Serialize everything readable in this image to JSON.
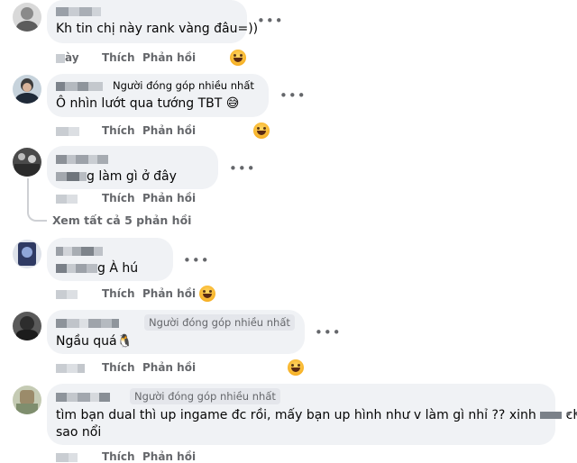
{
  "comments": [
    {
      "name_blur": true,
      "badge": "",
      "text": "Kh tin chị này rank vàng đâu=))",
      "time_blur": "ày",
      "like": "Thích",
      "reply": "Phản hồi",
      "has_reaction": true
    },
    {
      "name_blur": true,
      "badge": "Người đóng góp nhiều nhất",
      "text": "Ô nhìn lướt qua tướng TBT 😅",
      "time_blur": "",
      "like": "Thích",
      "reply": "Phản hồi",
      "has_reaction": true
    },
    {
      "name_blur": true,
      "badge": "",
      "text": "g làm gì ở đây",
      "time_blur": "",
      "like": "Thích",
      "reply": "Phản hồi",
      "has_reaction": false
    },
    {
      "name_blur": true,
      "badge": "",
      "text": "g À hú",
      "time_blur": "",
      "like": "Thích",
      "reply": "Phản hồi",
      "has_reaction": true
    },
    {
      "name_blur": true,
      "badge": "Người đóng góp nhiều nhất",
      "text": "Ngầu quá🐧",
      "time_blur": "",
      "like": "Thích",
      "reply": "Phản hồi",
      "has_reaction": true
    },
    {
      "name_blur": true,
      "badge": "Người đóng góp nhiều nhất",
      "text_line1": "tìm bạn dual thì up ingame đc rồi, mấy bạn up hình như v làm gì nhỉ ?? xinh",
      "text_line1_end": "chịu",
      "text_line2": "sao nổi",
      "time_blur": "",
      "like": "Thích",
      "reply": "Phản hồi",
      "has_reaction": false
    }
  ],
  "view_all_replies": "Xem tất cả 5 phản hồi",
  "more_icon": "more-dots-icon",
  "reaction_icon": "haha-reaction-icon",
  "colors": {
    "bubble": "#f0f2f5",
    "meta": "#65676b",
    "text": "#050505"
  }
}
